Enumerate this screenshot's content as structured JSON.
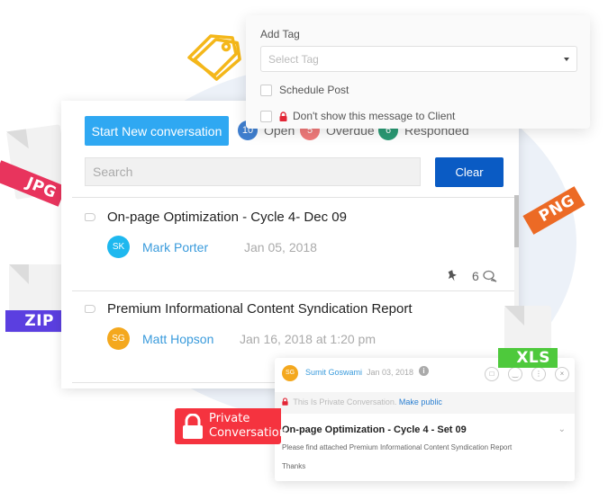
{
  "tag_popup": {
    "label": "Add Tag",
    "select_placeholder": "Select Tag",
    "options": [
      {
        "label": "Schedule Post",
        "checked": false
      },
      {
        "label": "Don't show this message to Client",
        "checked": false,
        "icon": "lock-icon"
      }
    ]
  },
  "toolbar": {
    "start_button": "Start New conversation",
    "statuses": [
      {
        "count": "10",
        "label": "Open",
        "color": "#3f7fd0"
      },
      {
        "count": "5",
        "label": "Overdue",
        "color": "#f07a7a"
      },
      {
        "count": "6",
        "label": "Responded",
        "color": "#2a9a74"
      }
    ],
    "search_placeholder": "Search",
    "clear_button": "Clear"
  },
  "conversations": [
    {
      "title": "On-page Optimization - Cycle 4- Dec 09",
      "initials": "SK",
      "avatar_color": "#1eb8ef",
      "author": "Mark Porter",
      "date": "Jan 05, 2018",
      "comments": "6"
    },
    {
      "title": "Premium Informational Content Syndication Report",
      "initials": "SG",
      "avatar_color": "#f4a81e",
      "author": "Matt Hopson",
      "date": "Jan 16, 2018 at 1:20 pm"
    }
  ],
  "chat_card": {
    "initials": "SG",
    "author": "Sumit Goswami",
    "date": "Jan 03, 2018",
    "private_notice": "This Is Private Conversation.",
    "make_public": "Make public",
    "title": "On-page Optimization - Cycle 4 - Set 09",
    "body": "Please find attached Premium Informational Content Syndication Report",
    "signoff": "Thanks"
  },
  "private_badge": {
    "line1": "Private",
    "line2": "Conversation"
  },
  "file_tags": {
    "jpg": {
      "label": "JPG",
      "color": "#e8345d"
    },
    "zip": {
      "label": "ZIP",
      "color": "#5b3fe0"
    },
    "png": {
      "label": "PNG",
      "color": "#ec6a25"
    },
    "xls": {
      "label": "XLS",
      "color": "#4ec93c"
    }
  }
}
